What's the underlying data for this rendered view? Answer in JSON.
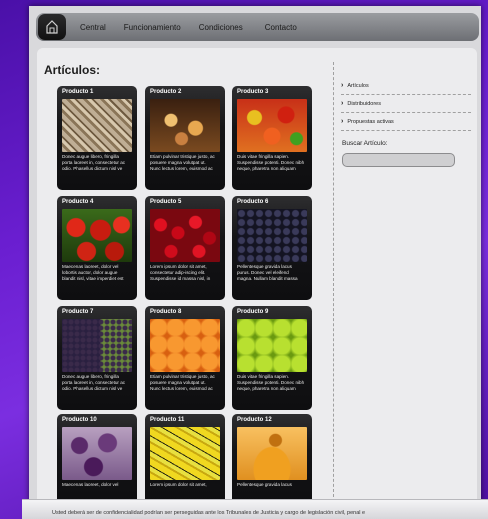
{
  "nav": {
    "items": [
      "Central",
      "Funcionamiento",
      "Condiciones",
      "Contacto"
    ]
  },
  "page_title": "Artículos:",
  "sidebar": {
    "links": [
      "Artículos",
      "Distribuidores",
      "Propuestas activas"
    ],
    "search_label": "Buscar Artículo:",
    "search_value": ""
  },
  "products": [
    {
      "title": "Producto 1",
      "text": "Donec augue libero, fringilla\nporta laoreet in, consectetur ac\nodio. Phasellus dictum nisl ve",
      "image": "nuts"
    },
    {
      "title": "Producto 2",
      "text": "Etiam pulvinar tristique justo, ac\nposuere magna volutpat ut.\nNunc lectus lorem, euismod ac",
      "image": "dried-fruit"
    },
    {
      "title": "Producto 3",
      "text": "Duis vitae fringilla sapien.\nSuspendisse potenti. Donec nibh\nneque, pharetra non aliquam",
      "image": "mixed-vegetables"
    },
    {
      "title": "Producto 4",
      "text": "Maecenas laoreet, dolor vel\nlobortis auctor, dolor augue\nblandit nisl, vitae imperdiet est",
      "image": "tomatoes"
    },
    {
      "title": "Producto 5",
      "text": "Lorem ipsum dolor sit amet,\nconsectetur adip-iscing elit.\nSuspendisse id massa nisl, in",
      "image": "cherries"
    },
    {
      "title": "Producto 6",
      "text": "Pellentesque gravida lacus\npurus. Donec vel eleifend\nmagna. Nullam blandit massa",
      "image": "blueberries"
    },
    {
      "title": "Producto 7",
      "text": "Donec augue libero, fringilla\nporta laoreet in, consectetur ac\nodio. Phasellus dictum nisl ve",
      "image": "grapes"
    },
    {
      "title": "Producto 8",
      "text": "Etiam pulvinar tristique justo, ac\nposuere magna volutpat ut.\nNunc lectus lorem, euismod ac",
      "image": "oranges"
    },
    {
      "title": "Producto 9",
      "text": "Duis vitae fringilla sapien.\nSuspendisse potenti. Donec nibh\nneque, pharetra non aliquam",
      "image": "green-apples"
    },
    {
      "title": "Producto 10",
      "text": "Maecenas laoreet, dolor vel",
      "image": "figs"
    },
    {
      "title": "Producto 11",
      "text": "Lorem ipsum dolor sit amet,",
      "image": "bananas"
    },
    {
      "title": "Producto 12",
      "text": "Pellentesque gravida lacus",
      "image": "honey"
    }
  ],
  "footer": {
    "text": "Usted deberá ser de confidencialidad podrían ser perseguidas ante los Tribunales de Justicia y cargo de legislación civil, penal e"
  },
  "colors": {
    "background": "#6a1ed0",
    "panel": "#ececee",
    "card": "#141416",
    "navbar": "#8a8c90"
  }
}
